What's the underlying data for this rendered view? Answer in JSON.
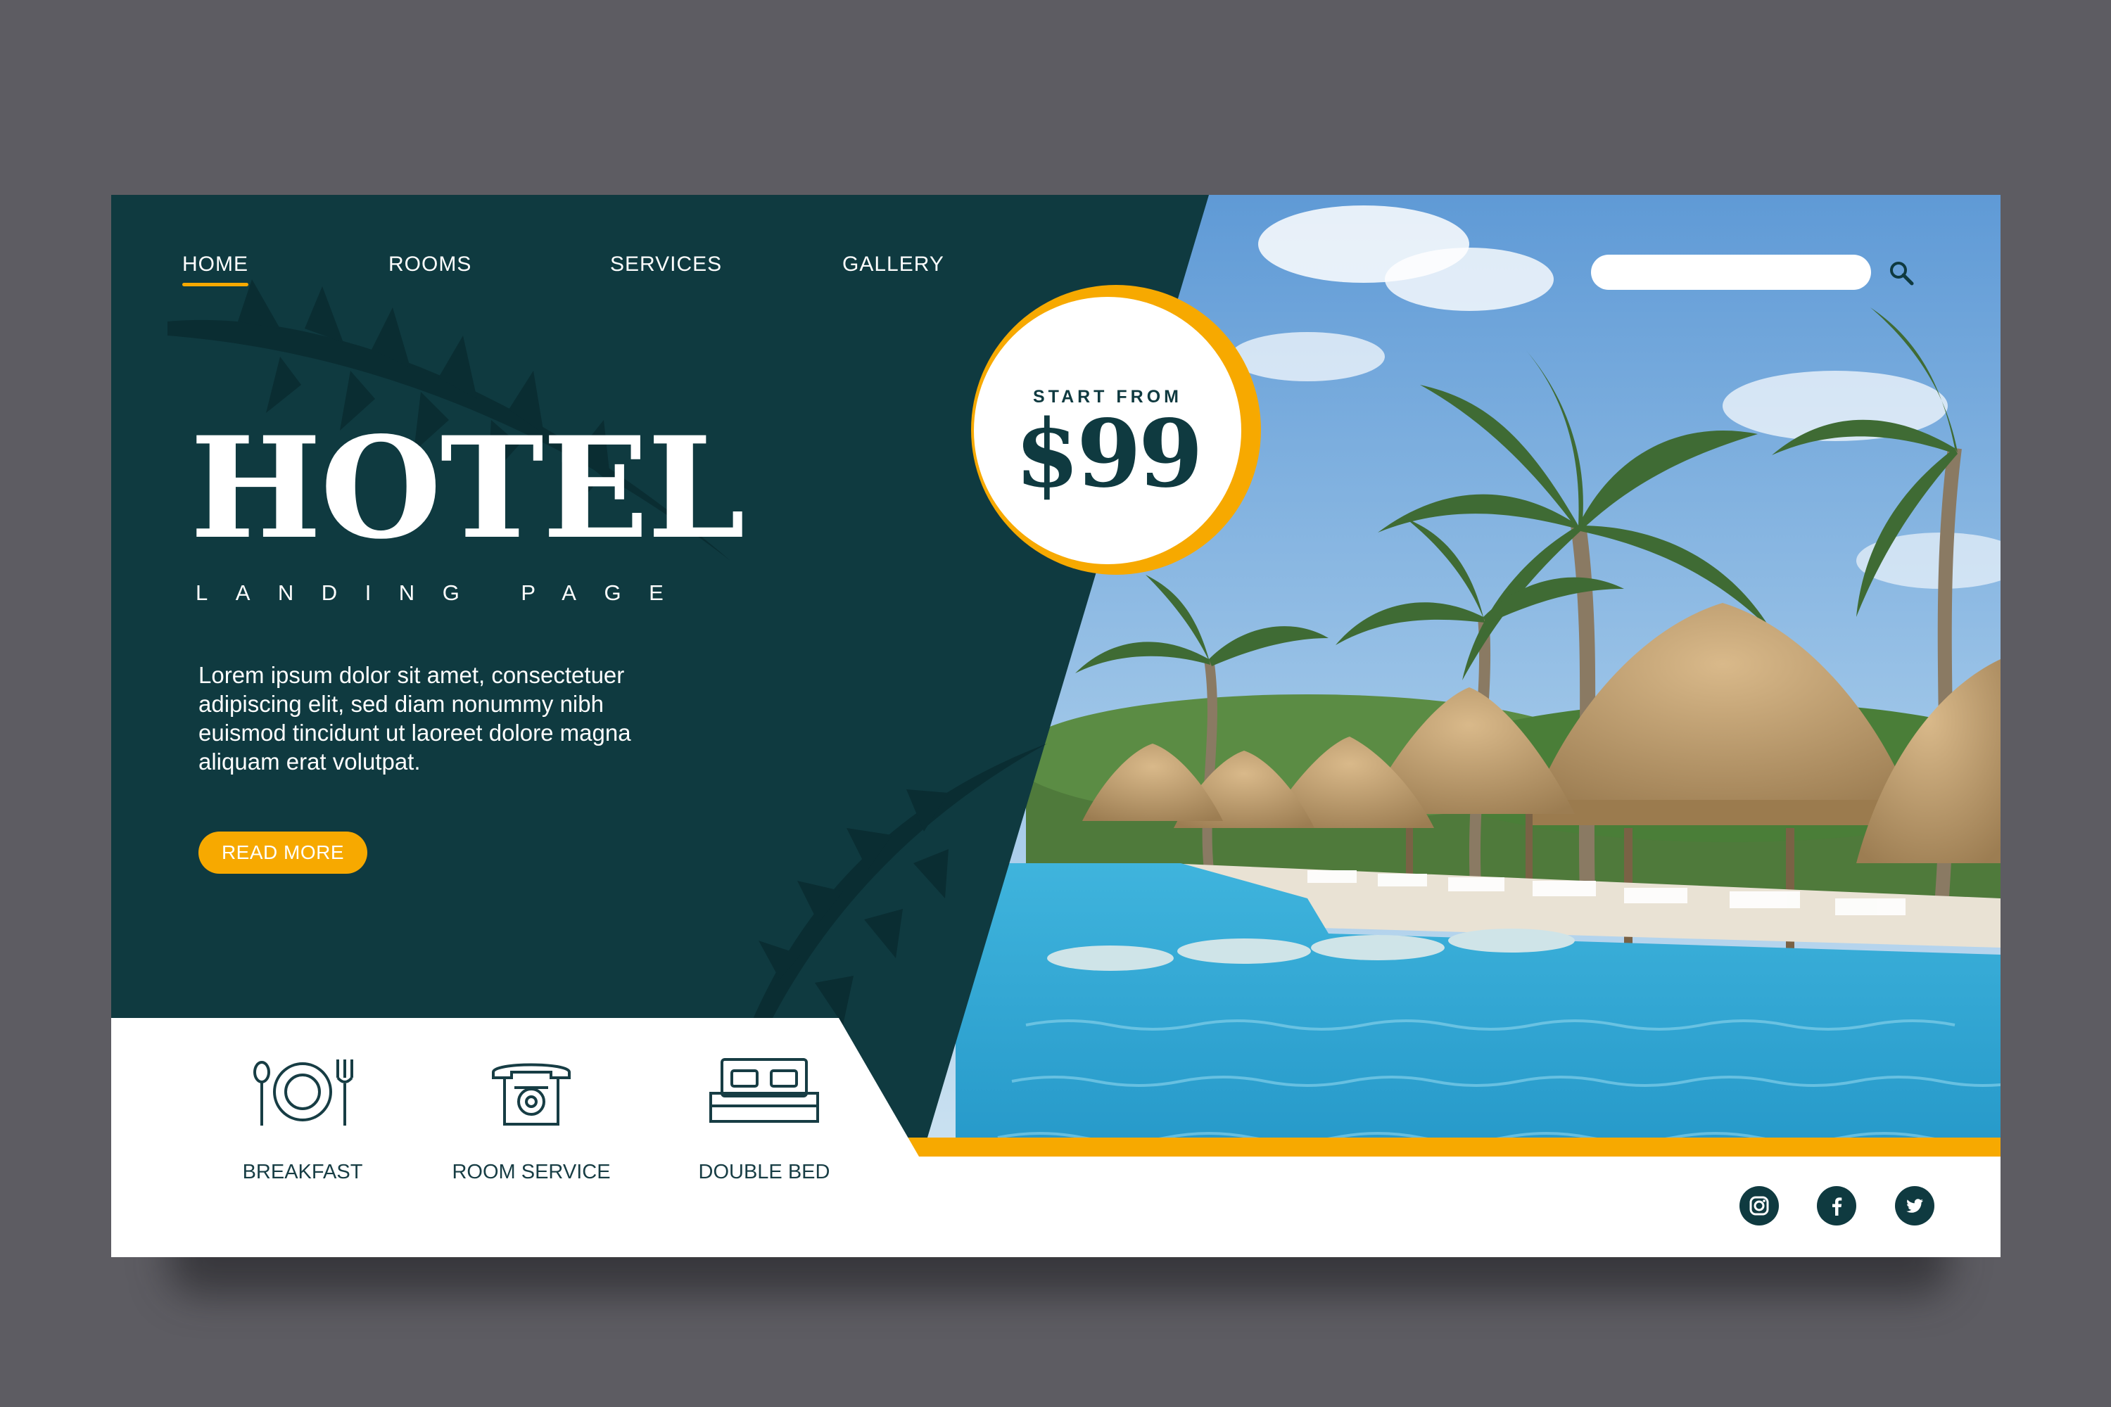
{
  "nav": {
    "items": [
      {
        "label": "HOME",
        "active": true
      },
      {
        "label": "ROOMS",
        "active": false
      },
      {
        "label": "SERVICES",
        "active": false
      },
      {
        "label": "GALLERY",
        "active": false
      }
    ]
  },
  "search": {
    "placeholder": "",
    "value": ""
  },
  "price_badge": {
    "label": "START FROM",
    "value": "$99"
  },
  "hero": {
    "title": "HOTEL",
    "subtitle": "LANDING PAGE",
    "body": "Lorem ipsum dolor sit amet, consectetuer adipiscing elit, sed diam nonummy nibh euismod tincidunt ut laoreet dolore magna aliquam erat volutpat.",
    "button_label": "READ MORE"
  },
  "features": [
    {
      "label": "BREAKFAST",
      "icon": "plate-cutlery-icon"
    },
    {
      "label": "ROOM SERVICE",
      "icon": "telephone-icon"
    },
    {
      "label": "DOUBLE BED",
      "icon": "double-bed-icon"
    }
  ],
  "social": [
    {
      "name": "instagram",
      "icon": "instagram-icon"
    },
    {
      "name": "facebook",
      "icon": "facebook-icon"
    },
    {
      "name": "twitter",
      "icon": "twitter-icon"
    }
  ],
  "colors": {
    "background": "#5d5c62",
    "panel": "#0f3a40",
    "accent": "#f7a900",
    "text_dark": "#173d44"
  }
}
